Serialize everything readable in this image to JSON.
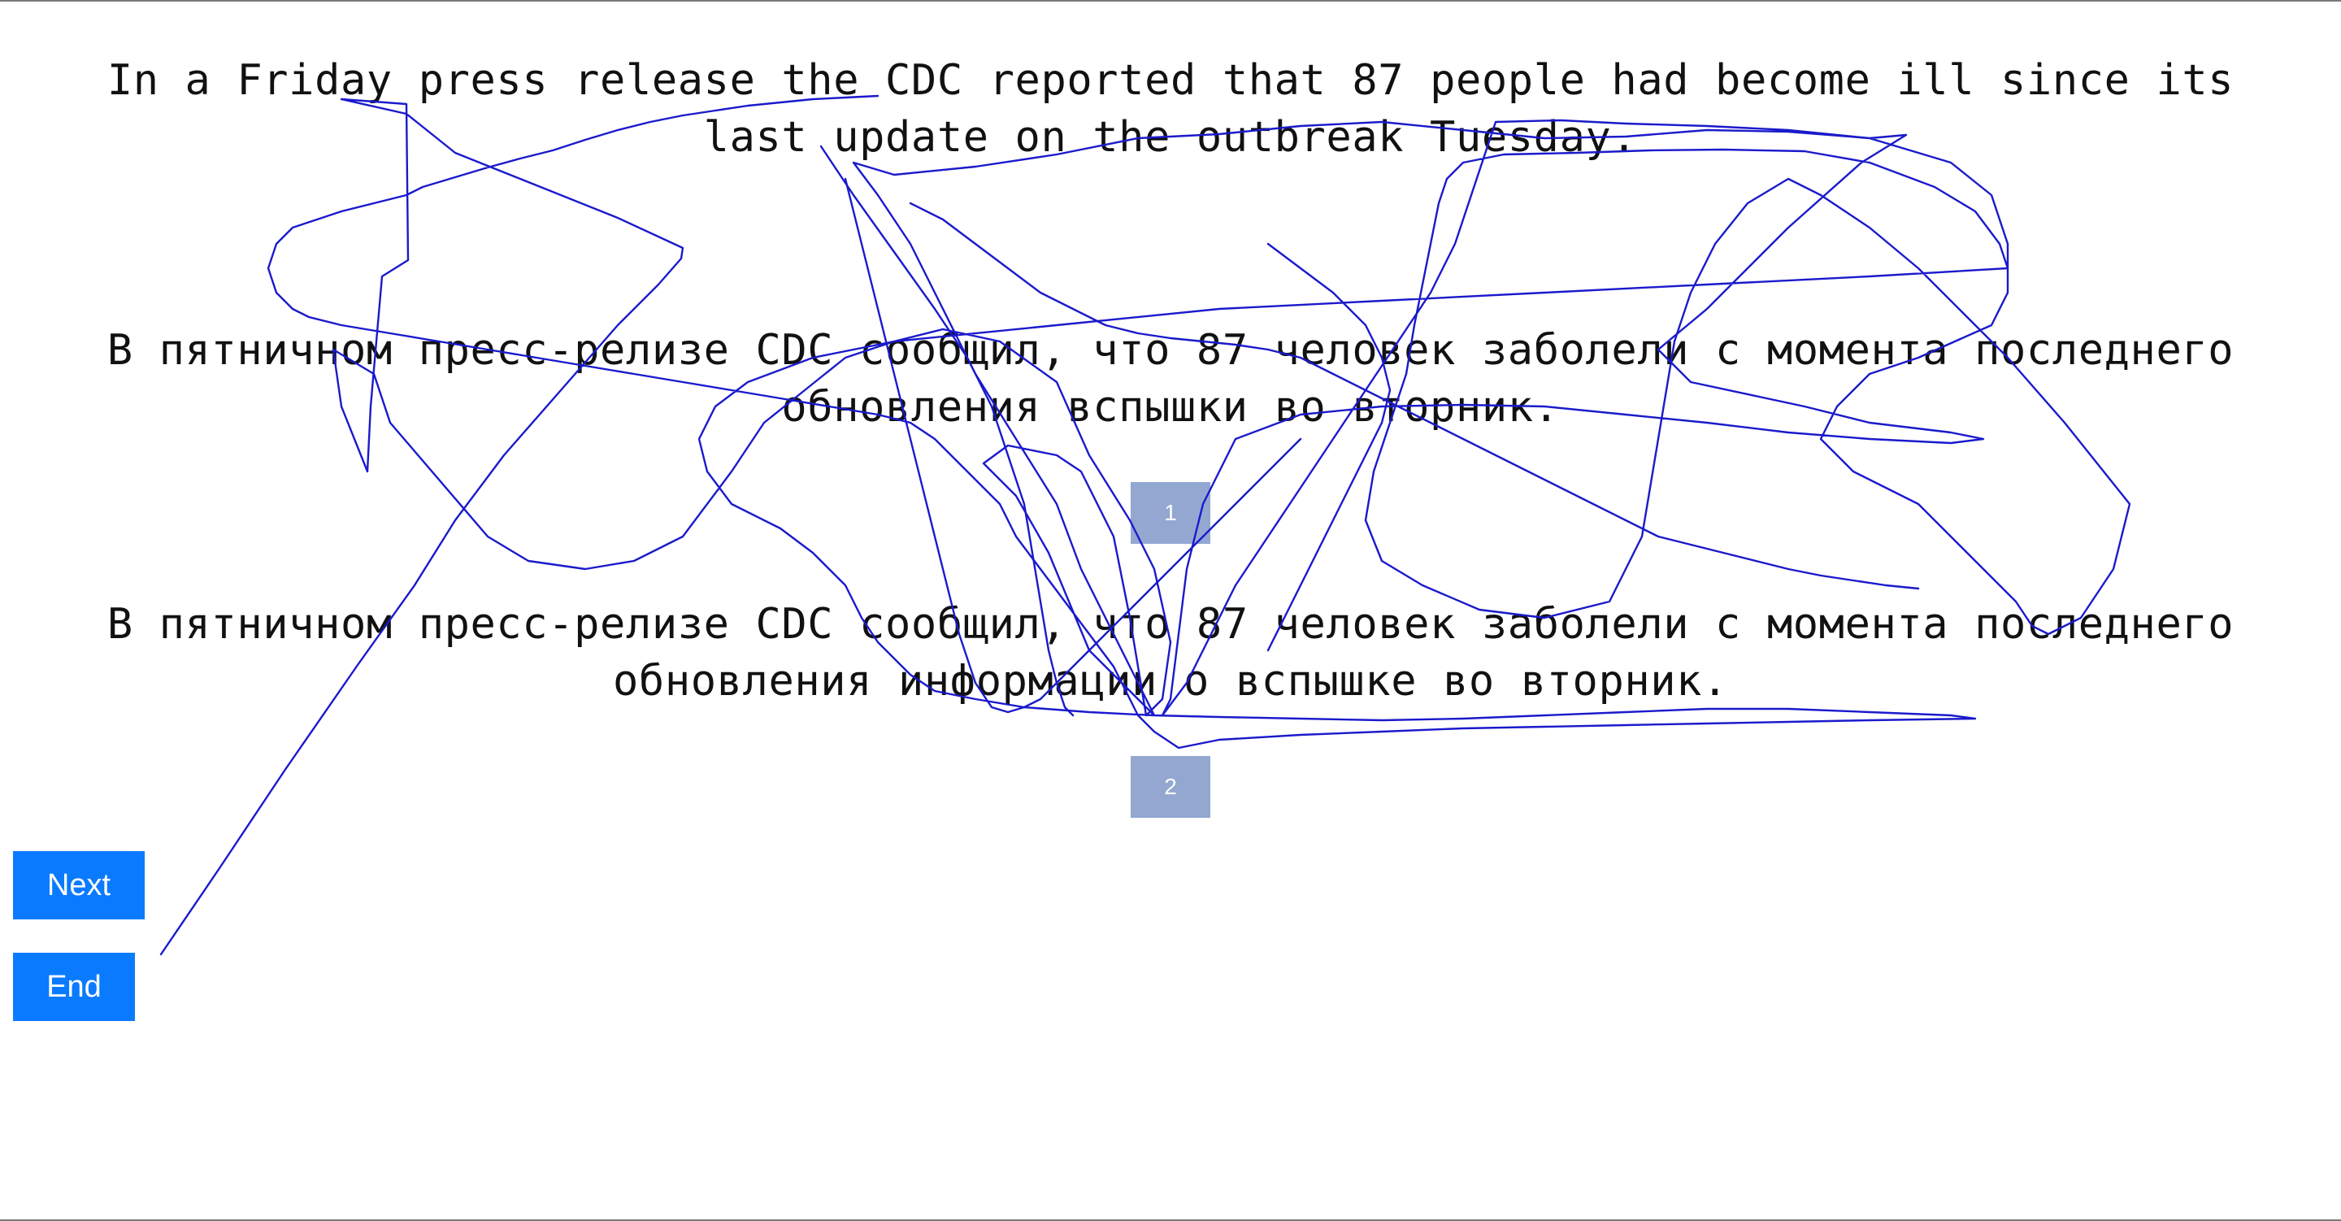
{
  "source_sentence": "In a Friday press release the CDC reported that 87 people had become ill since its last update on the outbreak Tuesday.",
  "translations": [
    {
      "text": "В пятничном пресс-релизе CDC сообщил, что 87 человек заболели с момента последнего обновления вспышки во вторник.",
      "rank_label": "1"
    },
    {
      "text": "В пятничном пресс-релизе CDC сообщил, что 87 человек заболели с момента последнего обновления информации о вспышке во вторник.",
      "rank_label": "2"
    }
  ],
  "buttons": {
    "next_label": "Next",
    "end_label": "End"
  },
  "colors": {
    "button_bg": "#0a7bff",
    "rank_box_bg": "#93a7d1",
    "scribble_stroke": "#1a1acc"
  }
}
